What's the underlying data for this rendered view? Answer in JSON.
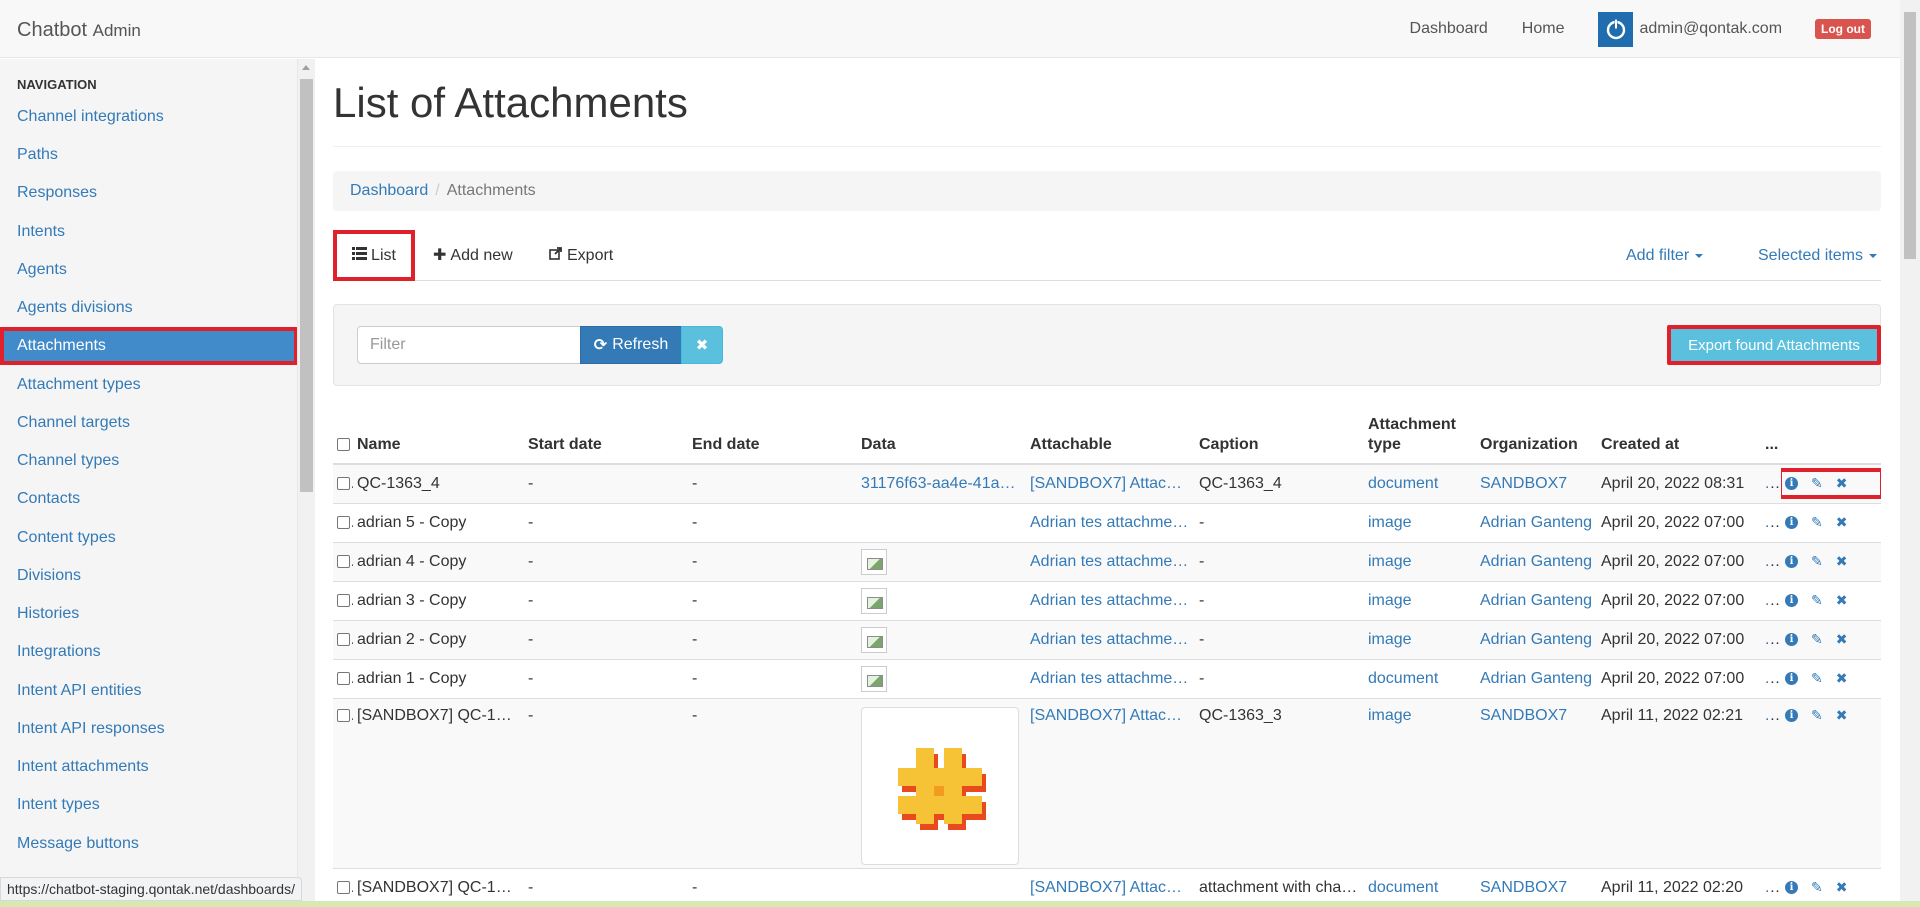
{
  "navbar": {
    "brand": "Chatbot",
    "brand_sub": "Admin",
    "links": [
      "Dashboard",
      "Home"
    ],
    "user_email": "admin@qontak.com",
    "logout_label": "Log out"
  },
  "sidebar": {
    "header": "NAVIGATION",
    "items": [
      "Channel integrations",
      "Paths",
      "Responses",
      "Intents",
      "Agents",
      "Agents divisions",
      "Attachments",
      "Attachment types",
      "Channel targets",
      "Channel types",
      "Contacts",
      "Content types",
      "Divisions",
      "Histories",
      "Integrations",
      "Intent API entities",
      "Intent API responses",
      "Intent attachments",
      "Intent types",
      "Message buttons"
    ],
    "active_item": "Attachments"
  },
  "main": {
    "title": "List of Attachments",
    "breadcrumb": {
      "root": "Dashboard",
      "current": "Attachments"
    },
    "tabs": {
      "list": "List",
      "add_new": "Add new",
      "export": "Export",
      "add_filter": "Add filter",
      "selected_items": "Selected items"
    },
    "filter": {
      "placeholder": "Filter",
      "refresh_label": "Refresh",
      "export_found_label": "Export found Attachments"
    },
    "table": {
      "headers": [
        "Name",
        "Start date",
        "End date",
        "Data",
        "Attachable",
        "Caption",
        "Attachment type",
        "Organization",
        "Created at",
        "..."
      ],
      "rows": [
        {
          "name": "QC-1363_4",
          "start": "-",
          "end": "-",
          "data": "31176f63-aa4e-41a…",
          "data_kind": "link",
          "attachable": "[SANDBOX7] Attac…",
          "caption": "QC-1363_4",
          "type": "document",
          "org": "SANDBOX7",
          "created": "April 20, 2022 08:31",
          "more": "..."
        },
        {
          "name": "adrian 5 - Copy",
          "start": "-",
          "end": "-",
          "data": "",
          "data_kind": "none",
          "attachable": "Adrian tes attachme…",
          "caption": "-",
          "type": "image",
          "org": "Adrian Ganteng",
          "created": "April 20, 2022 07:00",
          "more": "..."
        },
        {
          "name": "adrian 4 - Copy",
          "start": "-",
          "end": "-",
          "data": "",
          "data_kind": "broken",
          "attachable": "Adrian tes attachme…",
          "caption": "-",
          "type": "image",
          "org": "Adrian Ganteng",
          "created": "April 20, 2022 07:00",
          "more": "..."
        },
        {
          "name": "adrian 3 - Copy",
          "start": "-",
          "end": "-",
          "data": "",
          "data_kind": "broken",
          "attachable": "Adrian tes attachme…",
          "caption": "-",
          "type": "image",
          "org": "Adrian Ganteng",
          "created": "April 20, 2022 07:00",
          "more": "..."
        },
        {
          "name": "adrian 2 - Copy",
          "start": "-",
          "end": "-",
          "data": "",
          "data_kind": "broken",
          "attachable": "Adrian tes attachme…",
          "caption": "-",
          "type": "image",
          "org": "Adrian Ganteng",
          "created": "April 20, 2022 07:00",
          "more": "..."
        },
        {
          "name": "adrian 1 - Copy",
          "start": "-",
          "end": "-",
          "data": "",
          "data_kind": "broken",
          "attachable": "Adrian tes attachme…",
          "caption": "-",
          "type": "document",
          "org": "Adrian Ganteng",
          "created": "April 20, 2022 07:00",
          "more": "..."
        },
        {
          "name": "[SANDBOX7] QC-1…",
          "start": "-",
          "end": "-",
          "data": "",
          "data_kind": "thumbnail",
          "attachable": "[SANDBOX7] Attac…",
          "caption": "QC-1363_3",
          "type": "image",
          "org": "SANDBOX7",
          "created": "April 11, 2022 02:21",
          "more": "..."
        },
        {
          "name": "[SANDBOX7] QC-1…",
          "start": "-",
          "end": "-",
          "data": "",
          "data_kind": "none",
          "attachable": "[SANDBOX7] Attac…",
          "caption": "attachment with cha…",
          "type": "document",
          "org": "SANDBOX7",
          "created": "April 11, 2022 02:20",
          "more": "..."
        }
      ]
    }
  },
  "status_bar": {
    "url": "https://chatbot-staging.qontak.net/dashboards/"
  },
  "colors": {
    "link": "#337ab7",
    "primary": "#337ab7",
    "info": "#5bc0de",
    "danger": "#d9534f",
    "highlight": "#e0202a",
    "sidebar_active": "#428bca"
  }
}
